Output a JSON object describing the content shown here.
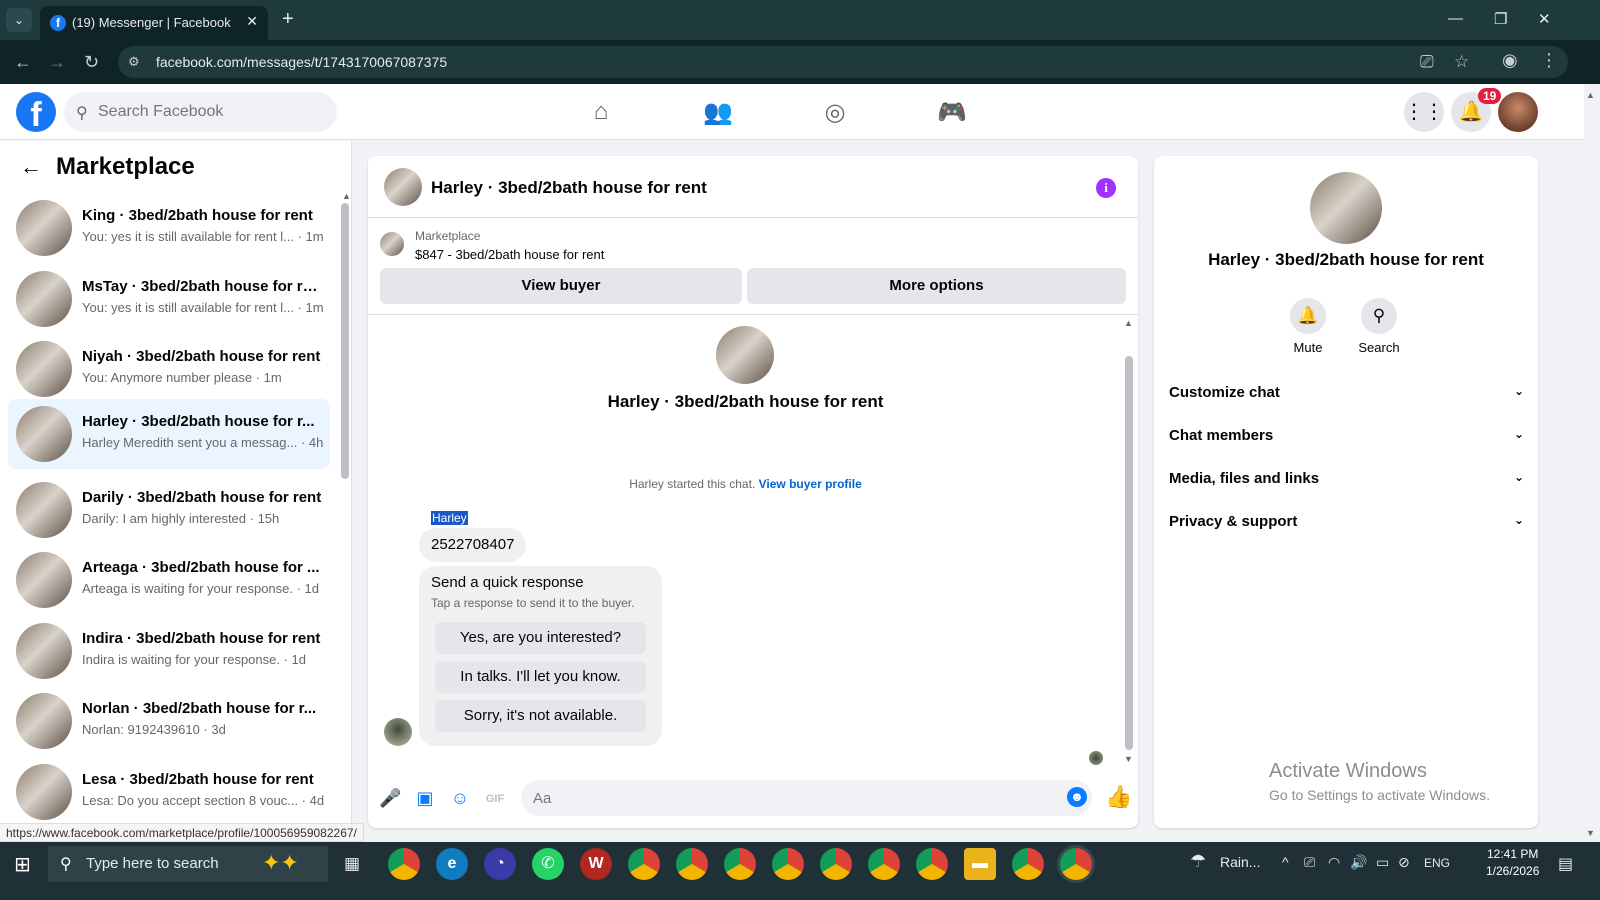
{
  "browser": {
    "tab_title": "(19) Messenger | Facebook",
    "url": "facebook.com/messages/t/1743170067087375",
    "status_url": "https://www.facebook.com/marketplace/profile/100056959082267/"
  },
  "fb_header": {
    "search_placeholder": "Search Facebook",
    "notification_count": "19"
  },
  "sidebar": {
    "title": "Marketplace",
    "conversations": [
      {
        "name": "King · 3bed/2bath house for rent",
        "snippet": "You: yes it is still available for rent l... · 1m",
        "active": false
      },
      {
        "name": "MsTay · 3bed/2bath house for re...",
        "snippet": "You: yes it is still available for rent l... · 1m",
        "active": false
      },
      {
        "name": "Niyah · 3bed/2bath house for rent",
        "snippet": "You: Anymore number please · 1m",
        "active": false
      },
      {
        "name": "Harley · 3bed/2bath house for r...",
        "snippet": "Harley Meredith sent you a messag... · 4h",
        "active": true
      },
      {
        "name": "Darily · 3bed/2bath house for rent",
        "snippet": "Darily: I am highly interested · 15h",
        "active": false
      },
      {
        "name": "Arteaga · 3bed/2bath house for ...",
        "snippet": "Arteaga is waiting for your response. · 1d",
        "active": false
      },
      {
        "name": "Indira · 3bed/2bath house for rent",
        "snippet": "Indira is waiting for your response. · 1d",
        "active": false
      },
      {
        "name": "Norlan · 3bed/2bath house for r...",
        "snippet": "Norlan: 9192439610 · 3d",
        "active": false
      },
      {
        "name": "Lesa · 3bed/2bath house for rent",
        "snippet": "Lesa: Do you accept section 8 vouc... · 4d",
        "active": false
      }
    ]
  },
  "chat": {
    "title": "Harley · 3bed/2bath house for rent",
    "marketplace_label": "Marketplace",
    "listing": "$847 - 3bed/2bath house for rent",
    "view_buyer": "View buyer",
    "more_options": "More options",
    "started_text": "Harley started this chat.",
    "view_buyer_profile": "View buyer profile",
    "sender": "Harley",
    "message": "2522708407",
    "quick_title": "Send a quick response",
    "quick_sub": "Tap a response to send it to the buyer.",
    "quick_responses": [
      "Yes, are you interested?",
      "In talks. I'll let you know.",
      "Sorry, it's not available."
    ],
    "input_placeholder": "Aa"
  },
  "details": {
    "name": "Harley · 3bed/2bath house for rent",
    "mute": "Mute",
    "search": "Search",
    "sections": [
      "Customize chat",
      "Chat members",
      "Media, files and links",
      "Privacy & support"
    ]
  },
  "watermark": {
    "line1": "Activate Windows",
    "line2": "Go to Settings to activate Windows."
  },
  "taskbar": {
    "search_text": "Type here to search",
    "weather": "Rain...",
    "lang": "ENG",
    "time": "12:41 PM",
    "date": "1/26/2026"
  },
  "colors": {
    "fb_blue": "#1877f2",
    "messenger_blue": "#0a7cff",
    "active_row": "#ebf5ff",
    "badge_red": "#e41e3f"
  }
}
